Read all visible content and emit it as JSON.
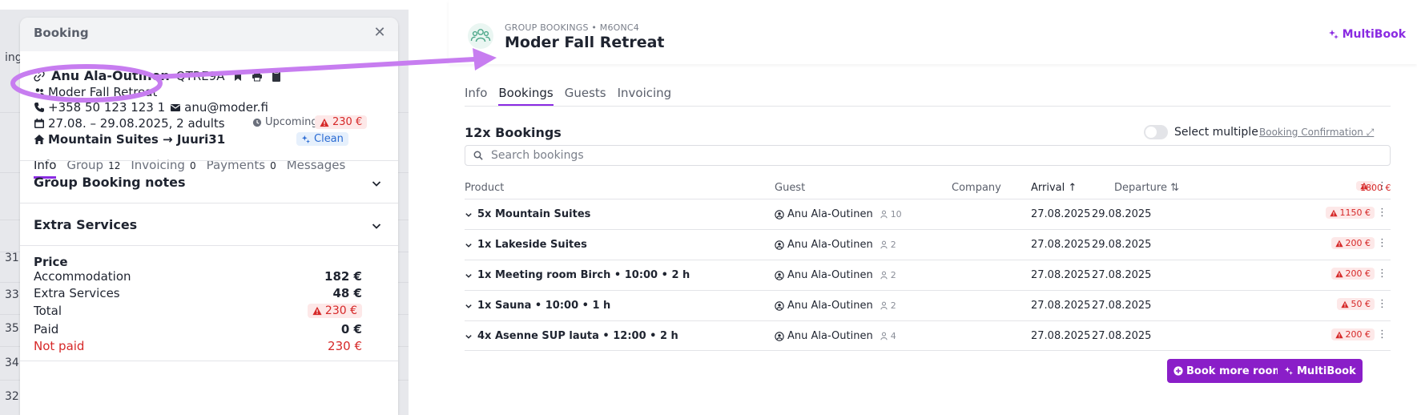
{
  "backdrop": {
    "fragments": [
      "ing",
      "31",
      "33",
      "35",
      "34",
      "32"
    ]
  },
  "booking": {
    "title": "Booking",
    "close_icon": "close-icon",
    "guest_name": "Anu Ala-Outinen",
    "reference": "QTRE9A",
    "group_name": "Moder Fall Retreat",
    "phone": "+358 50 123 123 1",
    "email": "anu@moder.fi",
    "dates": "27.08. – 29.08.2025, 2 adults",
    "status": "Upcoming",
    "balance": "230 €",
    "route": "Mountain Suites → Juuri31",
    "cleaning": "Clean",
    "tabs": [
      {
        "label": "Info",
        "count": ""
      },
      {
        "label": "Group",
        "count": "12"
      },
      {
        "label": "Invoicing",
        "count": "0"
      },
      {
        "label": "Payments",
        "count": "0"
      },
      {
        "label": "Messages",
        "count": ""
      }
    ],
    "sections": [
      "Group Booking notes",
      "Extra Services"
    ],
    "price": {
      "title": "Price",
      "rows": [
        {
          "label": "Accommodation",
          "value": "182 €"
        },
        {
          "label": "Extra Services",
          "value": "48 €"
        },
        {
          "label": "Total",
          "value": "230 €"
        },
        {
          "label": "Paid",
          "value": "0 €"
        },
        {
          "label": "Not paid",
          "value": "230 €"
        }
      ]
    }
  },
  "group": {
    "subtitle": "GROUP BOOKINGS • M6ONC4",
    "title": "Moder Fall Retreat",
    "multibook_link": "MultiBook",
    "tabs": [
      "Info",
      "Bookings",
      "Guests",
      "Invoicing"
    ],
    "active_tab": "Bookings",
    "count_label": "12x Bookings",
    "select_multiple": "Select multiple",
    "confirmation_link": "Booking Confirmation ⤢",
    "search_placeholder": "Search bookings",
    "columns": {
      "product": "Product",
      "guest": "Guest",
      "company": "Company",
      "arrival": "Arrival ↑",
      "departure": "Departure ⇅",
      "total": "1800 €"
    },
    "rows": [
      {
        "product": "5x Mountain Suites",
        "guest": "Anu Ala-Outinen",
        "guests": "10",
        "arrival": "27.08.2025",
        "departure": "29.08.2025",
        "amount": "1150 €"
      },
      {
        "product": "1x Lakeside Suites",
        "guest": "Anu Ala-Outinen",
        "guests": "2",
        "arrival": "27.08.2025",
        "departure": "29.08.2025",
        "amount": "200 €"
      },
      {
        "product": "1x Meeting room Birch • 10:00 • 2 h",
        "guest": "Anu Ala-Outinen",
        "guests": "2",
        "arrival": "27.08.2025",
        "departure": "27.08.2025",
        "amount": "200 €"
      },
      {
        "product": "1x Sauna • 10:00 • 1 h",
        "guest": "Anu Ala-Outinen",
        "guests": "2",
        "arrival": "27.08.2025",
        "departure": "27.08.2025",
        "amount": "50 €"
      },
      {
        "product": "4x Asenne SUP lauta • 12:00 • 2 h",
        "guest": "Anu Ala-Outinen",
        "guests": "4",
        "arrival": "27.08.2025",
        "departure": "27.08.2025",
        "amount": "200 €"
      }
    ],
    "buttons": {
      "book_more": "Book more rooms",
      "multibook": "MultiBook"
    }
  },
  "colors": {
    "accent": "#8a2be2",
    "button": "#8a1ec8",
    "alert": "#d62828",
    "annotation": "#c77df0"
  }
}
